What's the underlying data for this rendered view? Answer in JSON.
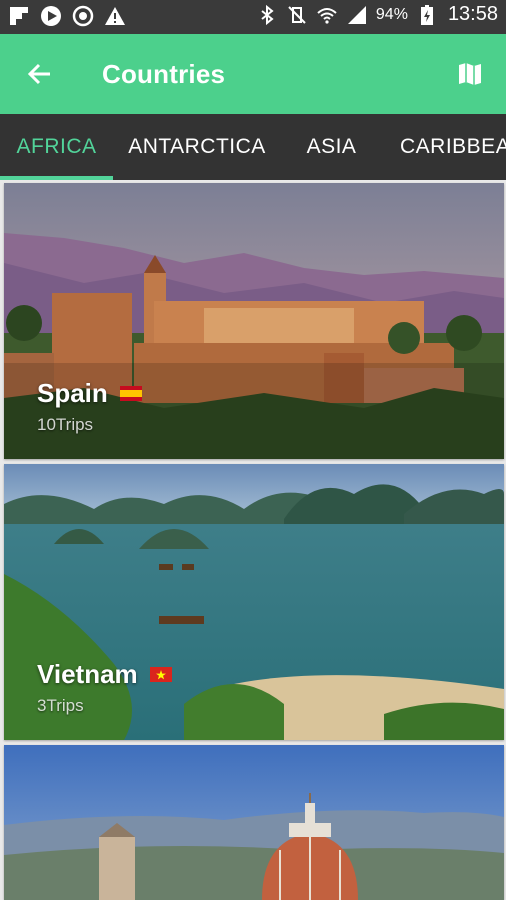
{
  "status_bar": {
    "battery": "94%",
    "time": "13:58"
  },
  "app_bar": {
    "title": "Countries",
    "back_icon": "arrow-back-icon",
    "map_icon": "map-icon"
  },
  "tabs": [
    {
      "label": "AFRICA",
      "active": true
    },
    {
      "label": "ANTARCTICA",
      "active": false
    },
    {
      "label": "ASIA",
      "active": false
    },
    {
      "label": "CARIBBEAN",
      "active": false
    }
  ],
  "countries": [
    {
      "name": "Spain",
      "trips": "10Trips",
      "flag": "spain-flag-icon"
    },
    {
      "name": "Vietnam",
      "trips": "3Trips",
      "flag": "vietnam-flag-icon"
    },
    {
      "name": "",
      "trips": "",
      "flag": ""
    }
  ],
  "colors": {
    "accent": "#4cd08c",
    "tab_bar": "#333333",
    "status_bar": "#3a3a3a"
  }
}
